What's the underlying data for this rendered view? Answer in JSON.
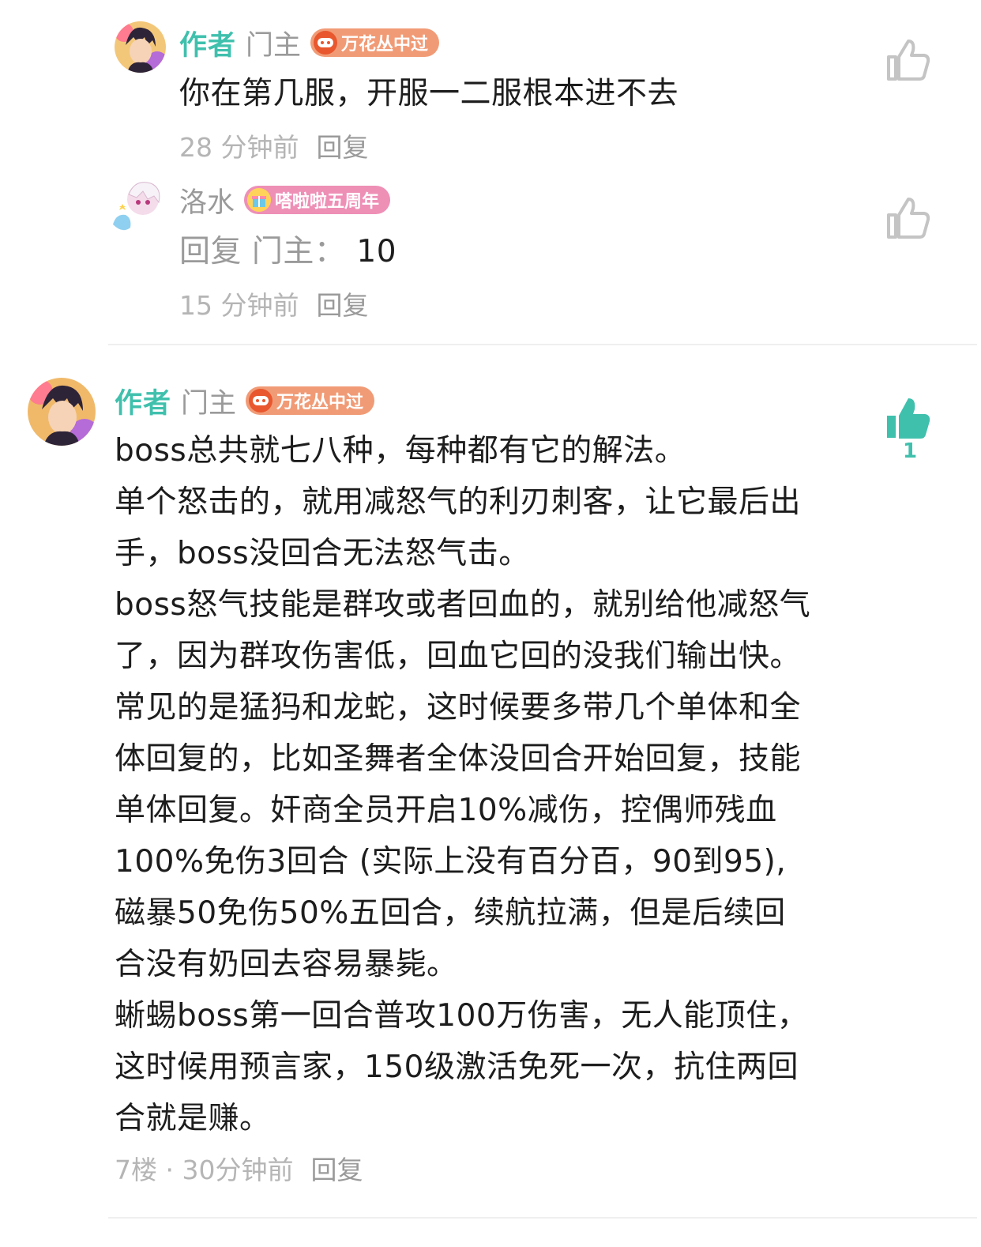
{
  "replies": [
    {
      "author_tag": "作者",
      "username": "门主",
      "medal": "万花丛中过",
      "text": "你在第几服，开服一二服根本进不去",
      "time": "28 分钟前",
      "reply_label": "回复"
    },
    {
      "username": "洛水",
      "medal": "嗒啦啦五周年",
      "reply_prefix": "回复 门主：",
      "text": "10",
      "time": "15 分钟前",
      "reply_label": "回复"
    }
  ],
  "post": {
    "author_tag": "作者",
    "username": "门主",
    "medal": "万花丛中过",
    "lines": [
      "boss总共就七八种，每种都有它的解法。",
      "单个怒击的，就用减怒气的利刃刺客，让它最后出",
      "手，boss没回合无法怒气击。",
      "boss怒气技能是群攻或者回血的，就别给他减怒气",
      "了，因为群攻伤害低，回血它回的没我们输出快。",
      "常见的是猛犸和龙蛇，这时候要多带几个单体和全",
      "体回复的，比如圣舞者全体没回合开始回复，技能",
      "单体回复。奸商全员开启10%减伤，控偶师残血",
      "100%免伤3回合 (实际上没有百分百，90到95),",
      "磁暴50免伤50%五回合，续航拉满，但是后续回",
      "合没有奶回去容易暴毙。",
      "蜥蜴boss第一回合普攻100万伤害，无人能顶住，",
      "这时候用预言家，150级激活免死一次，抗住两回",
      "合就是赚。"
    ],
    "meta": "7楼 · 30分钟前",
    "reply_label": "回复",
    "like_count": "1"
  },
  "colors": {
    "accent": "#3fc0ad",
    "medal_orange": "#f19b76",
    "medal_pink": "#ee8fb6",
    "muted": "#9a9a9a"
  }
}
